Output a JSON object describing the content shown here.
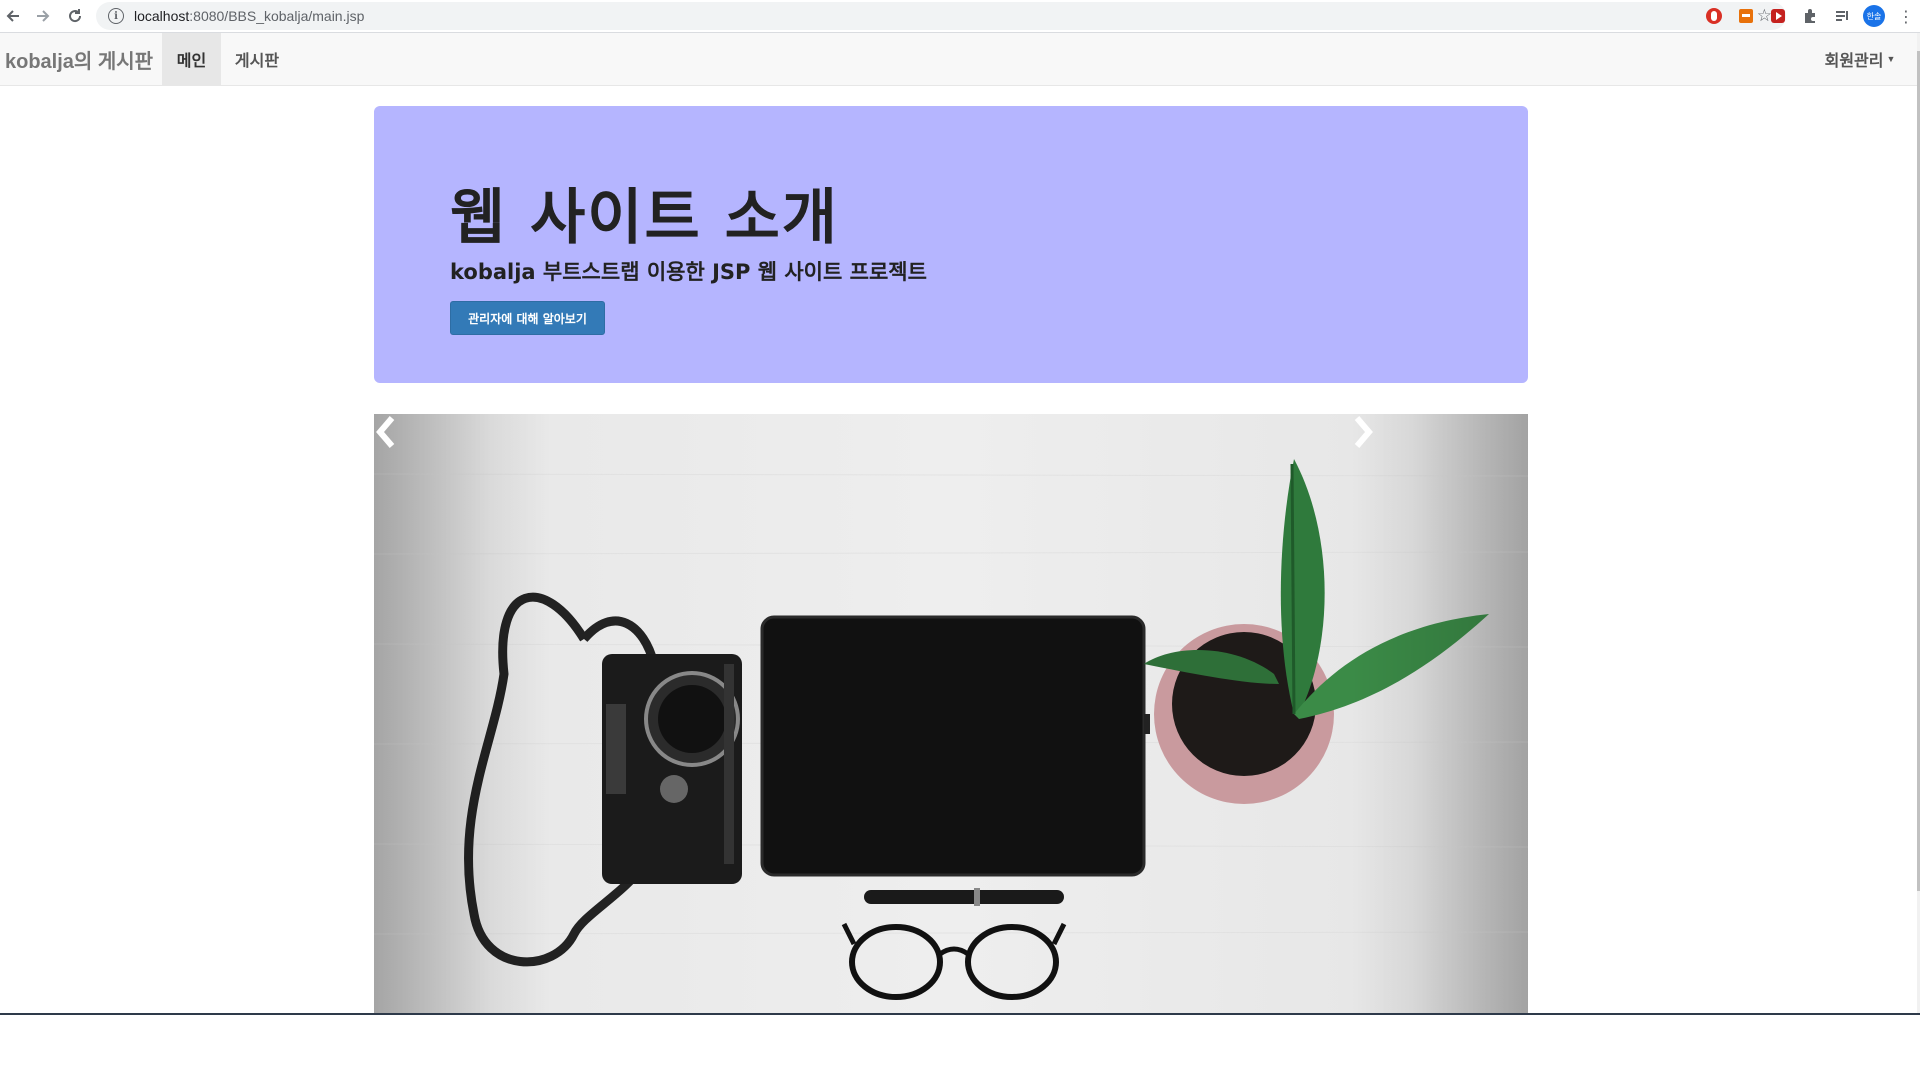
{
  "browser": {
    "url_host": "localhost",
    "url_path": ":8080/BBS_kobalja/main.jsp",
    "profile_initials": "한솔"
  },
  "navbar": {
    "brand": "kobalja의 게시판",
    "items": [
      {
        "label": "메인",
        "active": true
      },
      {
        "label": "게시판",
        "active": false
      }
    ],
    "member_menu": "회원관리"
  },
  "jumbotron": {
    "title": "웹 사이트 소개",
    "subtitle": "kobalja 부트스트랩 이용한 JSP 웹 사이트 프로젝트",
    "button_label": "관리자에 대해 알아보기",
    "background": "#b5b5ff",
    "button_color": "#337ab7"
  },
  "carousel": {
    "image": "camera-tablet-plant-photo",
    "prev_icon": "chevron-left-icon",
    "next_icon": "chevron-right-icon"
  }
}
